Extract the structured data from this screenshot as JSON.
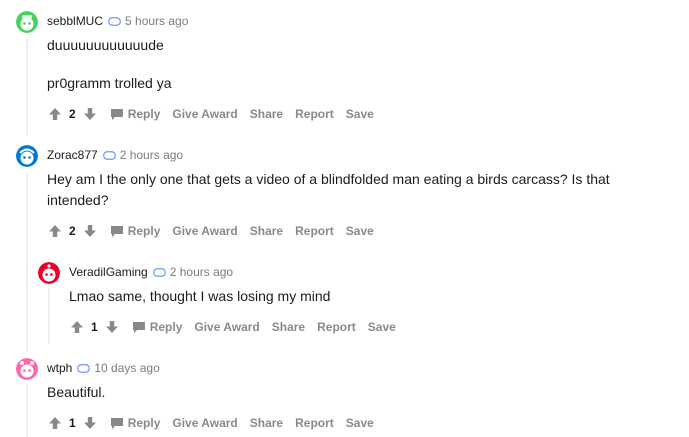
{
  "comments": [
    {
      "username": "sebblMUC",
      "time": "5 hours ago",
      "lines": [
        "duuuuuuuuuuuude",
        "pr0gramm trolled ya"
      ],
      "score": "2",
      "avatar_color": "#46d160"
    },
    {
      "username": "Zorac877",
      "time": "2 hours ago",
      "lines": [
        "Hey am I the only one that gets a video of a blindfolded man eating a birds carcass? Is that",
        "intended?"
      ],
      "score": "2",
      "avatar_color": "#0079d3"
    },
    {
      "username": "VeradilGaming",
      "time": "2 hours ago",
      "lines": [
        "Lmao same, thought I was losing my mind"
      ],
      "score": "1",
      "avatar_color": "#ea0027"
    },
    {
      "username": "wtph",
      "time": "10 days ago",
      "lines": [
        "Beautiful."
      ],
      "score": "1",
      "avatar_color": "#ff66ac"
    }
  ],
  "actions": {
    "reply": "Reply",
    "give_award": "Give Award",
    "share": "Share",
    "report": "Report",
    "save": "Save"
  },
  "icons": {
    "upvote": "upvote-icon",
    "downvote": "downvote-icon",
    "reply": "reply-icon",
    "status": "message-icon"
  }
}
